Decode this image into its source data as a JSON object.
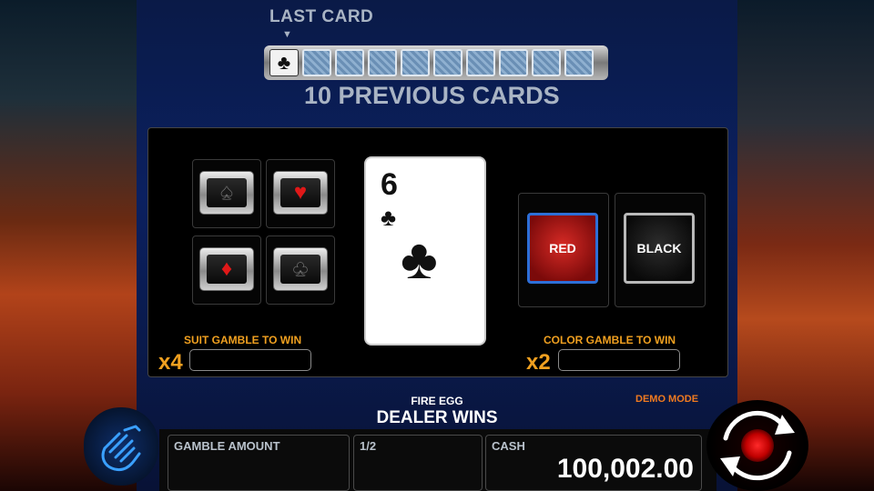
{
  "header": {
    "last_card_label": "LAST CARD",
    "arrow": "▼",
    "previous_cards_label": "10 PREVIOUS CARDS"
  },
  "previous_cards": [
    {
      "type": "face",
      "suit": "♣"
    },
    {
      "type": "back"
    },
    {
      "type": "back"
    },
    {
      "type": "back"
    },
    {
      "type": "back"
    },
    {
      "type": "back"
    },
    {
      "type": "back"
    },
    {
      "type": "back"
    },
    {
      "type": "back"
    },
    {
      "type": "back"
    }
  ],
  "suit_buttons": [
    {
      "suit": "♠",
      "color": "#1a1a1a",
      "name": "spade"
    },
    {
      "suit": "♥",
      "color": "#e01818",
      "name": "heart"
    },
    {
      "suit": "♦",
      "color": "#e01818",
      "name": "diamond"
    },
    {
      "suit": "♣",
      "color": "#1a1a1a",
      "name": "club"
    }
  ],
  "current_card": {
    "rank": "6",
    "suit": "♣"
  },
  "color_buttons": {
    "red": "RED",
    "black": "BLACK"
  },
  "suit_gamble": {
    "label": "SUIT GAMBLE TO WIN",
    "multiplier": "x4",
    "value": ""
  },
  "color_gamble": {
    "label": "COLOR GAMBLE TO WIN",
    "multiplier": "x2",
    "value": ""
  },
  "status": {
    "game_name": "FIRE EGG",
    "message": "DEALER WINS",
    "mode": "DEMO MODE"
  },
  "bottom": {
    "gamble_amount_label": "GAMBLE AMOUNT",
    "gamble_amount_value": "",
    "fraction_label": "1/2",
    "cash_label": "CASH",
    "cash_value": "100,002.00"
  },
  "colors": {
    "accent_orange": "#f0a020",
    "demo_orange": "#f07a20",
    "red_button_border": "#2d6fd8"
  },
  "icons": {
    "hand": "hand-collect-icon",
    "spin": "spin-refresh-icon"
  }
}
